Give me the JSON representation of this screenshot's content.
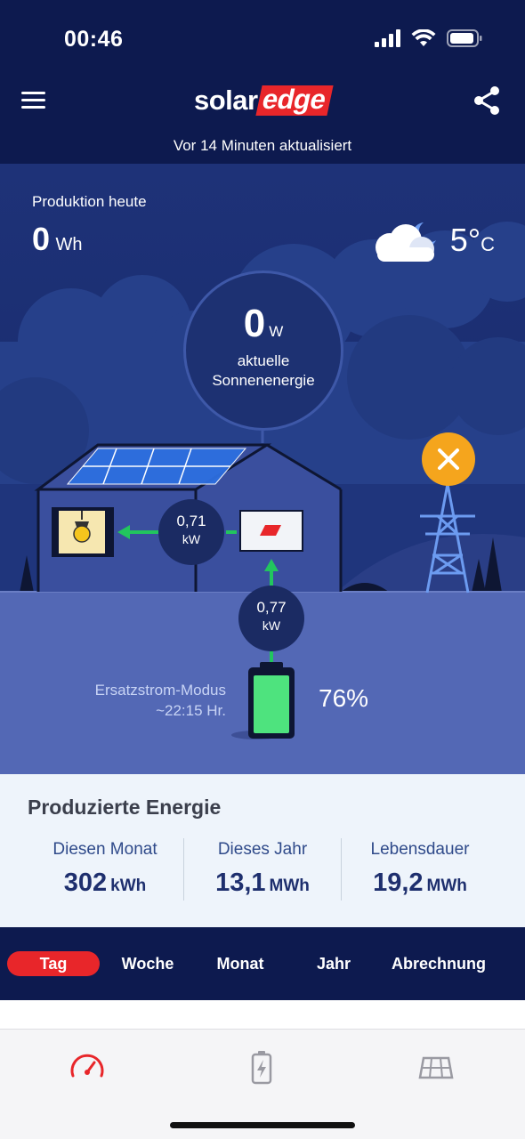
{
  "status_bar": {
    "time": "00:46"
  },
  "header": {
    "logo_solar": "solar",
    "logo_edge": "edge",
    "updated": "Vor 14 Minuten aktualisiert"
  },
  "production": {
    "label": "Produktion heute",
    "value": "0",
    "unit": "Wh"
  },
  "weather": {
    "icon": "cloud-moon-icon",
    "temp": "5°",
    "unit": "C"
  },
  "solar": {
    "value": "0",
    "unit": "W",
    "label_line1": "aktuelle",
    "label_line2": "Sonnenenergie"
  },
  "flows": {
    "house": {
      "value": "0,71",
      "unit": "kW"
    },
    "battery": {
      "value": "0,77",
      "unit": "kW"
    }
  },
  "grid": {
    "status_icon": "close-icon",
    "status_color": "#f5a51d"
  },
  "backup": {
    "label_line1": "Ersatzstrom-Modus",
    "label_line2": "~22:15 Hr."
  },
  "battery": {
    "percent": "76%",
    "level": 0.76,
    "color": "#4ee37e"
  },
  "energy": {
    "title": "Produzierte Energie",
    "columns": [
      {
        "label": "Diesen Monat",
        "value": "302",
        "unit": "kWh"
      },
      {
        "label": "Dieses Jahr",
        "value": "13,1",
        "unit": "MWh"
      },
      {
        "label": "Lebensdauer",
        "value": "19,2",
        "unit": "MWh"
      }
    ]
  },
  "tabs": [
    {
      "label": "Tag",
      "active": true
    },
    {
      "label": "Woche"
    },
    {
      "label": "Monat"
    },
    {
      "label": "Jahr"
    },
    {
      "label": "Abrechnung"
    }
  ],
  "bottom_nav": [
    {
      "icon": "dashboard-gauge-icon",
      "active": true
    },
    {
      "icon": "battery-icon"
    },
    {
      "icon": "solar-panel-icon"
    }
  ],
  "colors": {
    "accent": "#e8262a",
    "navy": "#0d1a4f",
    "flow_green": "#22c55e"
  }
}
